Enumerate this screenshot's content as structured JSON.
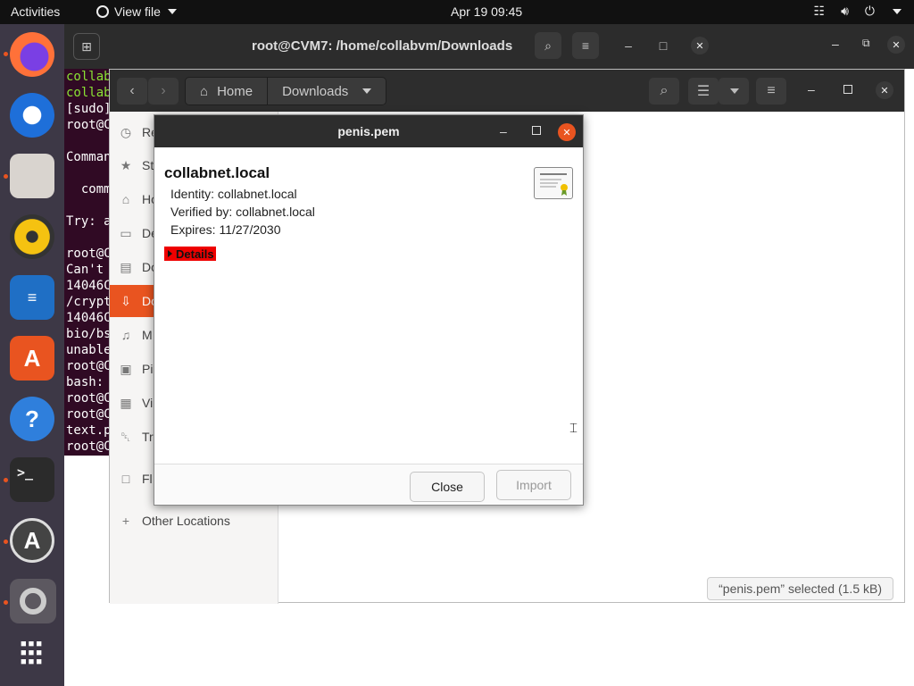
{
  "topbar": {
    "activities": "Activities",
    "app_menu": "View file",
    "clock": "Apr 19  09:45"
  },
  "dock": {
    "items": [
      "firefox",
      "thunderbird",
      "files",
      "rhythmbox",
      "libreoffice-writer",
      "ubuntu-software",
      "help",
      "terminal",
      "software-updater",
      "settings",
      "show-applications"
    ]
  },
  "terminal": {
    "title": "root@CVM7: /home/collabvm/Downloads",
    "lines": [
      {
        "text": "collab",
        "green": true
      },
      {
        "text": "collab",
        "green": true
      },
      {
        "text": "[sudo]",
        "green": false
      },
      {
        "text": "root@C",
        "green": false
      },
      {
        "text": "",
        "green": false
      },
      {
        "text": "Comman",
        "green": false
      },
      {
        "text": "",
        "green": false
      },
      {
        "text": "  comm",
        "green": false
      },
      {
        "text": "",
        "green": false
      },
      {
        "text": "Try: a",
        "green": false
      },
      {
        "text": "",
        "green": false
      },
      {
        "text": "root@C",
        "green": false
      },
      {
        "text": "Can't ",
        "green": false
      },
      {
        "text": "14046C",
        "green": false
      },
      {
        "text": "/crypt",
        "green": false
      },
      {
        "text": "14046C",
        "green": false
      },
      {
        "text": "bio/bs",
        "green": false
      },
      {
        "text": "unable",
        "green": false
      },
      {
        "text": "root@C",
        "green": false
      },
      {
        "text": "bash: ",
        "green": false
      },
      {
        "text": "root@C",
        "green": false
      },
      {
        "text": "root@C",
        "green": false
      },
      {
        "text": "text.p",
        "green": false
      },
      {
        "text": "root@C",
        "green": false
      }
    ]
  },
  "files": {
    "path": {
      "home": "Home",
      "current": "Downloads"
    },
    "sidebar": [
      {
        "label": "Re",
        "icon": "recent-icon"
      },
      {
        "label": "St",
        "icon": "star-icon"
      },
      {
        "label": "Ho",
        "icon": "home-icon"
      },
      {
        "label": "De",
        "icon": "desktop-icon"
      },
      {
        "label": "Do",
        "icon": "documents-icon"
      },
      {
        "label": "Do",
        "icon": "downloads-icon",
        "active": true
      },
      {
        "label": "M",
        "icon": "music-icon"
      },
      {
        "label": "Pi",
        "icon": "pictures-icon"
      },
      {
        "label": "Vi",
        "icon": "videos-icon"
      },
      {
        "label": "Tr",
        "icon": "trash-icon"
      },
      {
        "label": "Fl",
        "icon": "floppy-icon"
      },
      {
        "label": "Other Locations",
        "icon": "plus-icon"
      }
    ],
    "status": "“penis.pem” selected  (1.5 kB)"
  },
  "dialog": {
    "title": "penis.pem",
    "cert_name": "collabnet.local",
    "identity": "Identity: collabnet.local",
    "verified_by": "Verified by: collabnet.local",
    "expires": "Expires: 11/27/2030",
    "details": "Details",
    "close": "Close",
    "import": "Import"
  }
}
